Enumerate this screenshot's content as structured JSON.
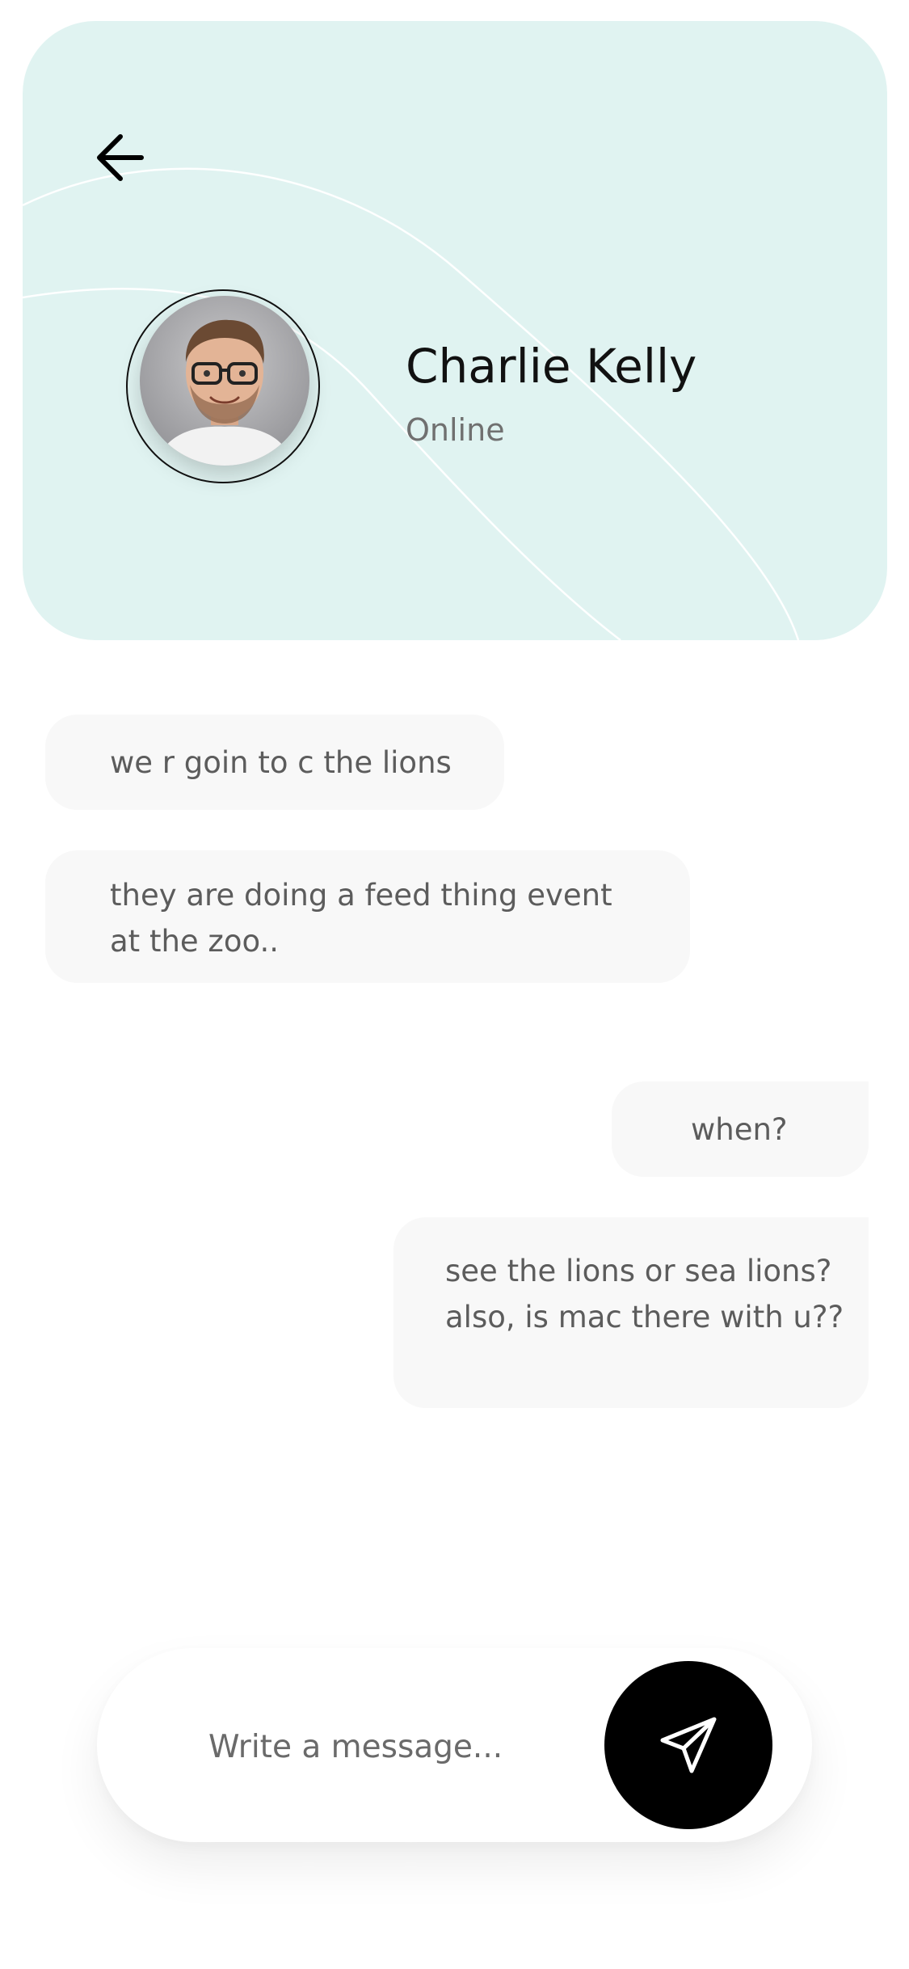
{
  "header": {
    "contact_name": "Charlie Kelly",
    "status": "Online",
    "background_color": "#e0f3f1",
    "back_icon": "arrow-left-icon"
  },
  "messages": [
    {
      "direction": "incoming",
      "text": "we r goin to c the lions"
    },
    {
      "direction": "incoming",
      "text": "they are doing a feed thing event at the zoo.."
    },
    {
      "direction": "outgoing",
      "text": "when?"
    },
    {
      "direction": "outgoing",
      "text": "see the lions or sea lions? also, is mac there with u??"
    }
  ],
  "composer": {
    "placeholder": "Write a message...",
    "send_icon": "send-icon"
  }
}
